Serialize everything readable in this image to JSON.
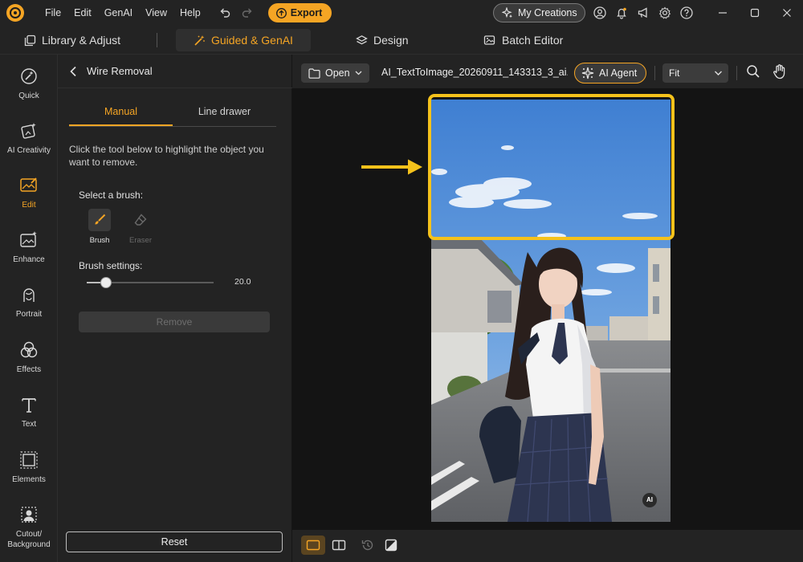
{
  "menu": [
    "File",
    "Edit",
    "GenAI",
    "View",
    "Help"
  ],
  "toolbar": {
    "export_label": "Export",
    "my_creations_label": "My Creations"
  },
  "mode_tabs": [
    "Library & Adjust",
    "Guided & GenAI",
    "Design",
    "Batch Editor"
  ],
  "rail": [
    "Quick",
    "AI Creativity",
    "Edit",
    "Enhance",
    "Portrait",
    "Effects",
    "Text",
    "Elements",
    "Cutout/\nBackground"
  ],
  "panel": {
    "title": "Wire Removal",
    "tabs": [
      "Manual",
      "Line drawer"
    ],
    "description": "Click the tool below to highlight the object you want to remove.",
    "brush_title": "Select a brush:",
    "brushes": [
      "Brush",
      "Eraser"
    ],
    "settings_title": "Brush settings:",
    "brush_size": "20.0",
    "brush_size_fraction": 0.15,
    "remove_label": "Remove",
    "reset_label": "Reset"
  },
  "editor": {
    "open_label": "Open",
    "filename": "AI_TextToImage_20260911_143313_3_ai....",
    "ai_agent_label": "AI Agent",
    "zoom_mode": "Fit",
    "ai_badge": "AI"
  },
  "colors": {
    "accent": "#f5a524",
    "highlight": "#f5c21b",
    "panel_bg": "#232323",
    "canvas_bg": "#141414"
  }
}
